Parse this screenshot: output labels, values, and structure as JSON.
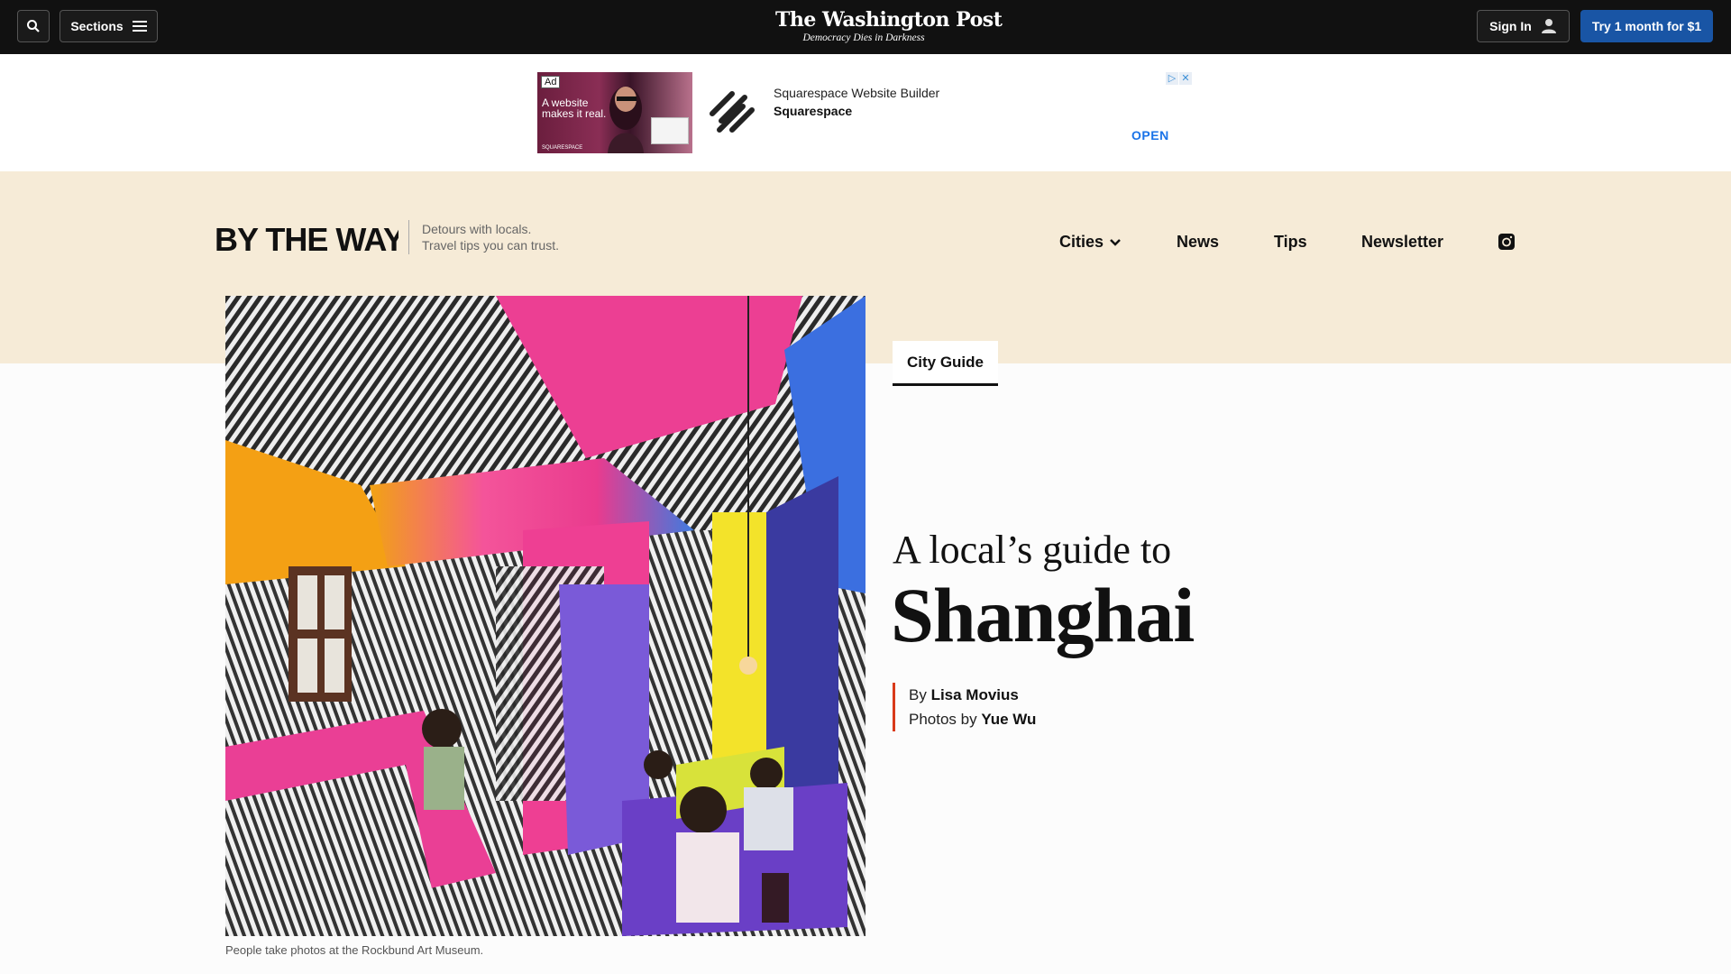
{
  "topbar": {
    "sections_label": "Sections",
    "masthead_title": "The Washington Post",
    "masthead_tagline": "Democracy Dies in Darkness",
    "signin_label": "Sign In",
    "subscribe_label": "Try 1 month for $1"
  },
  "ad": {
    "label": "Ad",
    "image_text": "A website makes it real.",
    "image_brand": "SQUARESPACE",
    "headline": "Squarespace Website Builder",
    "advertiser": "Squarespace",
    "cta": "OPEN"
  },
  "section_header": {
    "logo_text": "BY THE WAY",
    "tagline_line1": "Detours with locals.",
    "tagline_line2": "Travel tips you can trust.",
    "nav": [
      {
        "label": "Cities"
      },
      {
        "label": "News"
      },
      {
        "label": "Tips"
      },
      {
        "label": "Newsletter"
      }
    ]
  },
  "article": {
    "tab_label": "City Guide",
    "kicker": "A local’s guide to",
    "title": "Shanghai",
    "by_prefix": "By",
    "author": "Lisa Movius",
    "photos_prefix": "Photos by",
    "photographer": "Yue Wu",
    "caption": "People take photos at the Rockbund Art Museum."
  },
  "colors": {
    "topbar_bg": "#111111",
    "subscribe_bg": "#1955a5",
    "band_bg": "#f6ebd7",
    "byline_accent": "#d93a1a"
  }
}
